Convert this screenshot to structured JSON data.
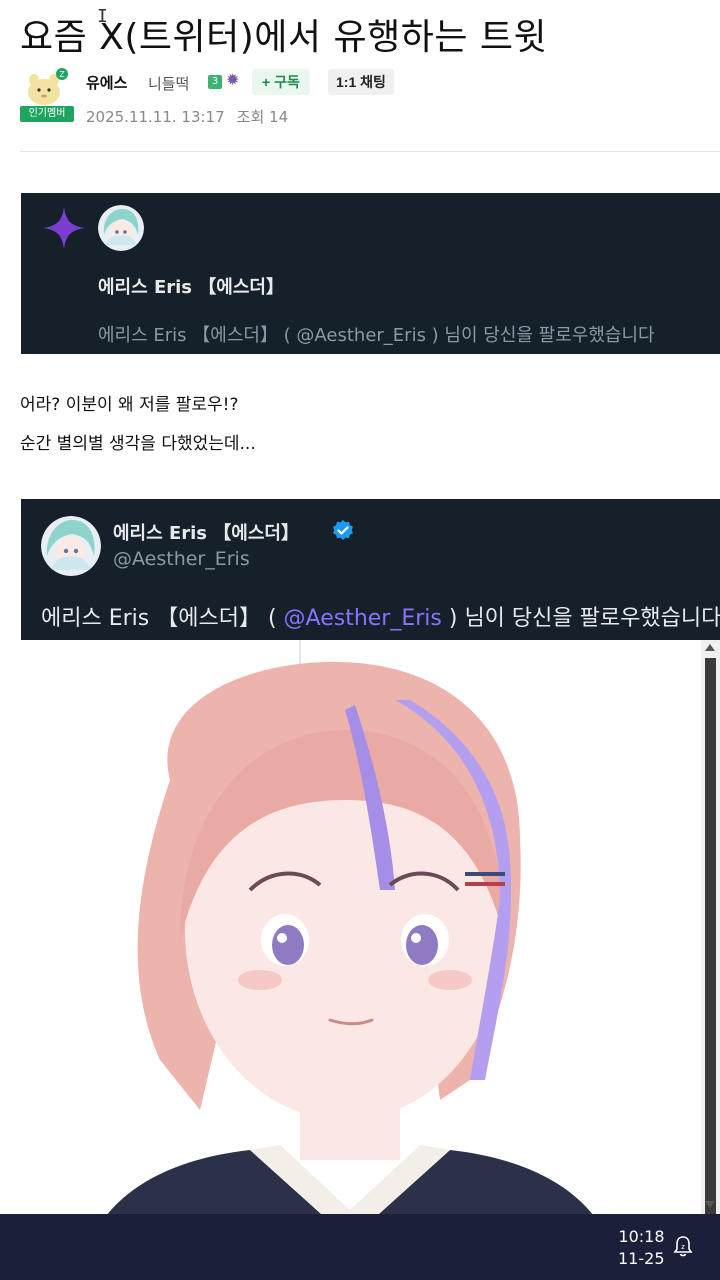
{
  "post": {
    "title": "요즘 X(트위터)에서 유행하는 트윗",
    "author": {
      "name": "유에스",
      "rank": "니들떡",
      "level": "3",
      "popular_badge": "인기멤버"
    },
    "subscribe_label": "+ 구독",
    "chat_label": "1:1 채팅",
    "date": "2025.11.11. 13:17",
    "views_label": "조회 14"
  },
  "notification": {
    "name": "에리스 Eris 【에스더】",
    "text": "에리스 Eris 【에스더】 ( @Aesther_Eris ) 님이 당신을 팔로우했습니다"
  },
  "body": {
    "line1": "어라? 이분이 왜 저를 팔로우!?",
    "line2": "순간 별의별 생각을 다했었는데..."
  },
  "tweet": {
    "name": "에리스 Eris 【에스더】",
    "handle": "@Aesther_Eris",
    "text_before": "에리스 Eris 【에스더】 ( ",
    "mention": "@Aesther_Eris",
    "text_after": " ) 님이 당신을 팔로우했습니다"
  },
  "taskbar": {
    "time": "10:18",
    "date": "11-25"
  },
  "colors": {
    "card_bg": "#15202b",
    "mention": "#8a72ff",
    "verified": "#1d9bf0",
    "sparkle": "#7a3fd1",
    "badge_green": "#1ea361",
    "taskbar": "#1c1f3a"
  },
  "icons": [
    "sparkle-icon",
    "verified-icon",
    "notification-bell-icon",
    "text-cursor-icon"
  ]
}
